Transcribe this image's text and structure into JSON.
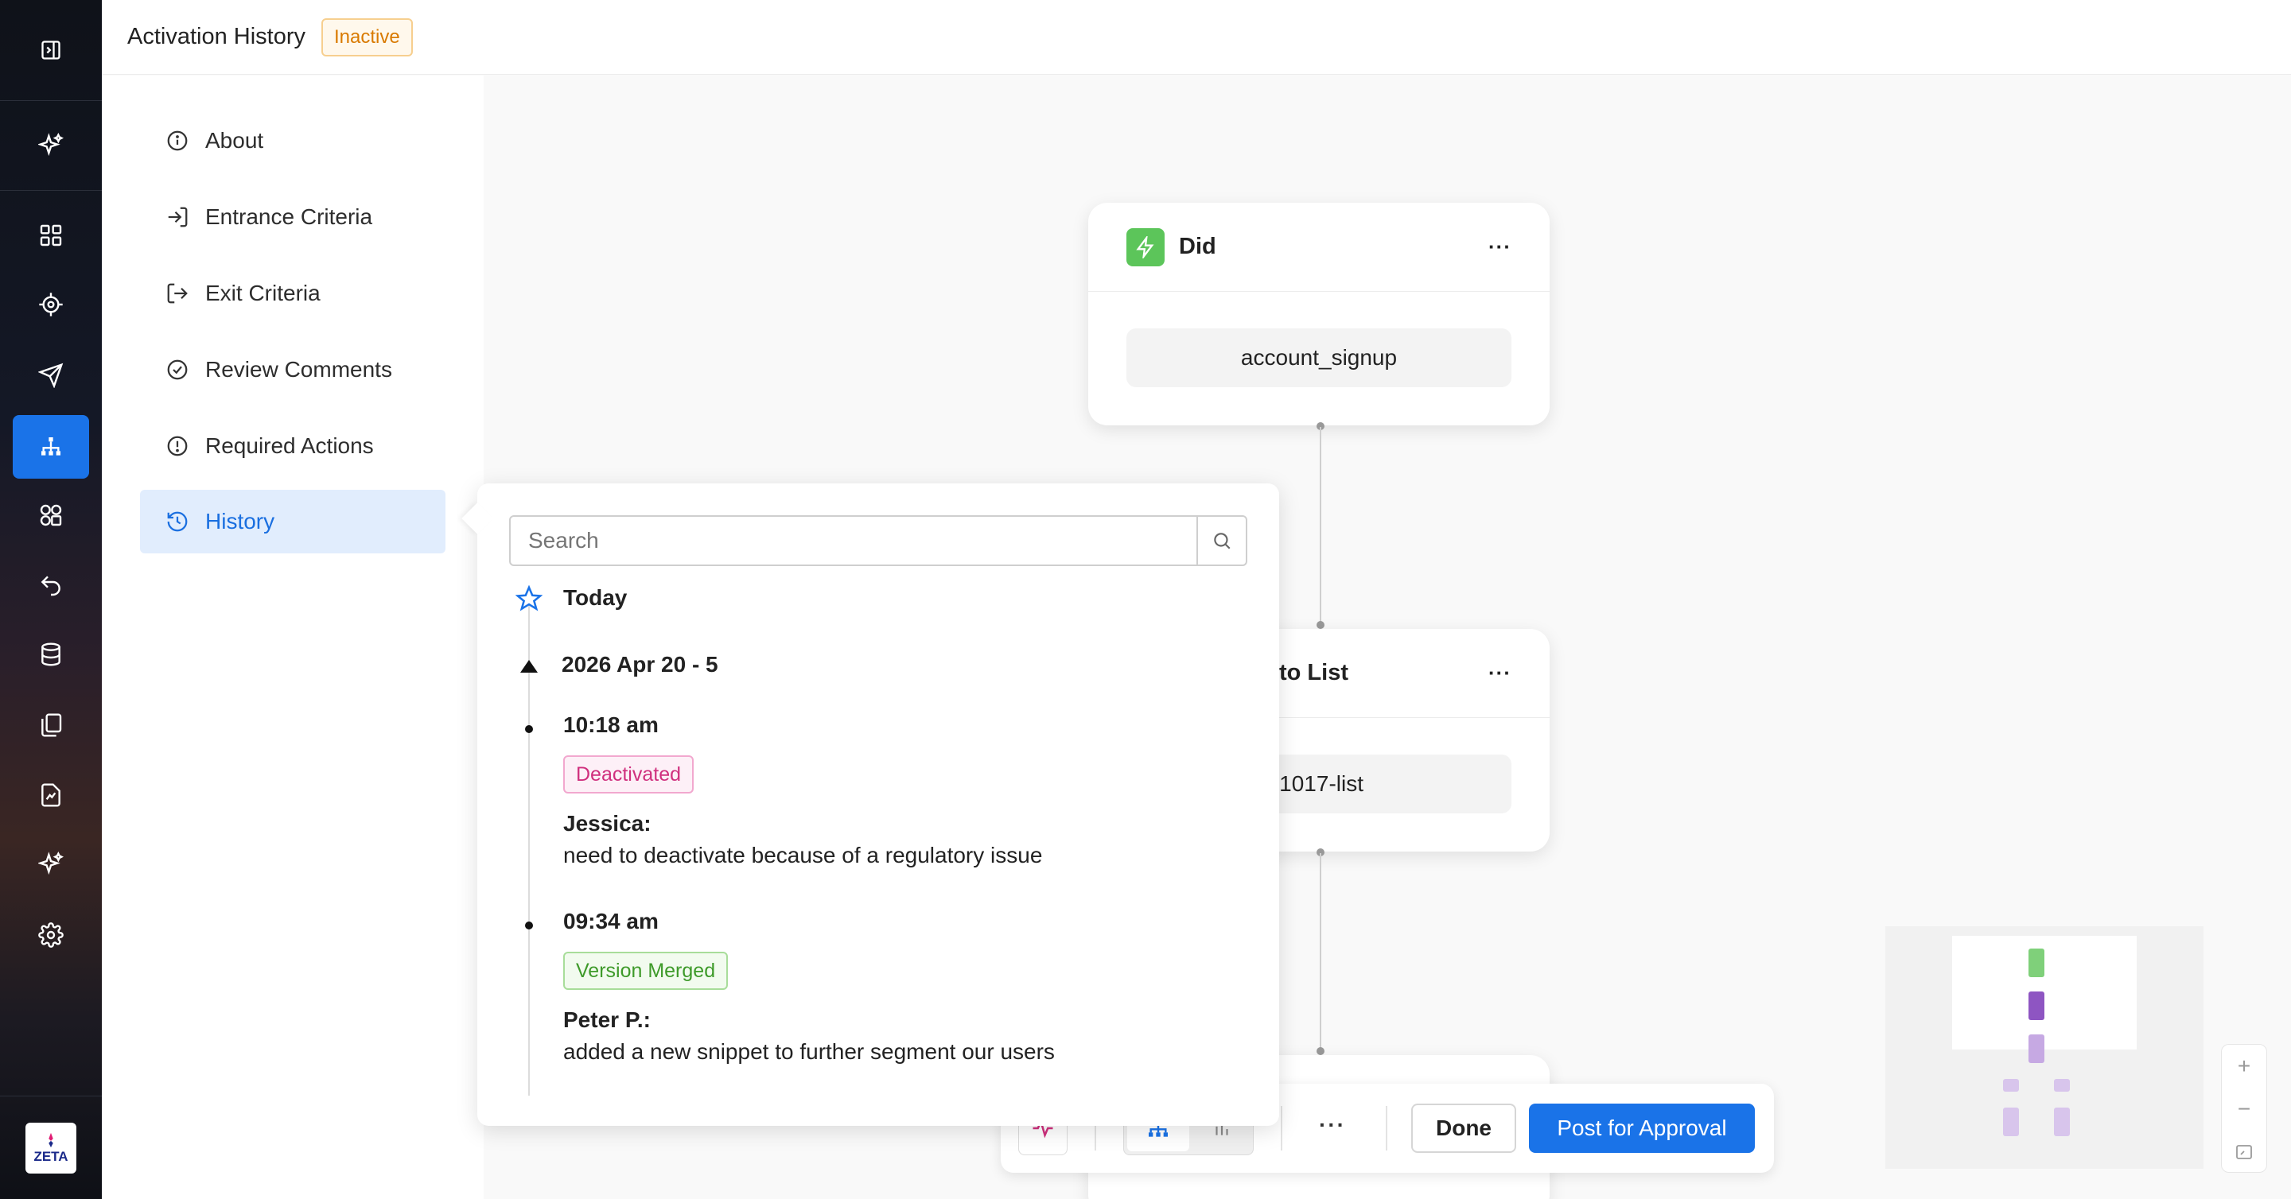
{
  "header": {
    "title": "Activation History",
    "status_badge": "Inactive"
  },
  "nav": {
    "items": [
      {
        "label": "About",
        "icon": "info-icon"
      },
      {
        "label": "Entrance Criteria",
        "icon": "enter-icon"
      },
      {
        "label": "Exit Criteria",
        "icon": "exit-icon"
      },
      {
        "label": "Review Comments",
        "icon": "check-circle-icon"
      },
      {
        "label": "Required Actions",
        "icon": "alert-circle-icon"
      },
      {
        "label": "History",
        "icon": "history-icon",
        "active": true
      }
    ]
  },
  "rail": {
    "icons": [
      "collapse-icon",
      "sparkle-icon",
      "dashboard-icon",
      "target-icon",
      "send-icon",
      "journey-icon",
      "segments-icon",
      "recall-icon",
      "database-icon",
      "content-icon",
      "reports-icon",
      "ai-icon",
      "settings-icon"
    ],
    "logo_text": "ZETA"
  },
  "canvas": {
    "node1": {
      "title": "Did",
      "value": "account_signup"
    },
    "node2": {
      "title": "to List",
      "value": "1017-list"
    }
  },
  "history": {
    "search_placeholder": "Search",
    "today_label": "Today",
    "group_label": "2026 Apr 20 - 5",
    "entries": [
      {
        "time": "10:18 am",
        "tag": "Deactivated",
        "author": "Jessica:",
        "comment": "need to deactivate because of a regulatory issue"
      },
      {
        "time": "09:34 am",
        "tag": "Version Merged",
        "author": "Peter P.:",
        "comment": "added a new snippet to further segment our users"
      }
    ]
  },
  "toolbar": {
    "more_label": "···",
    "done_label": "Done",
    "post_label": "Post for Approval"
  },
  "zoom": {
    "plus": "+",
    "minus": "−"
  },
  "colors": {
    "accent": "#1a73e8",
    "inactive": "#d97a00",
    "deactivated": "#d0307e",
    "merged": "#3e9a2a",
    "did_green": "#5cc55a"
  }
}
